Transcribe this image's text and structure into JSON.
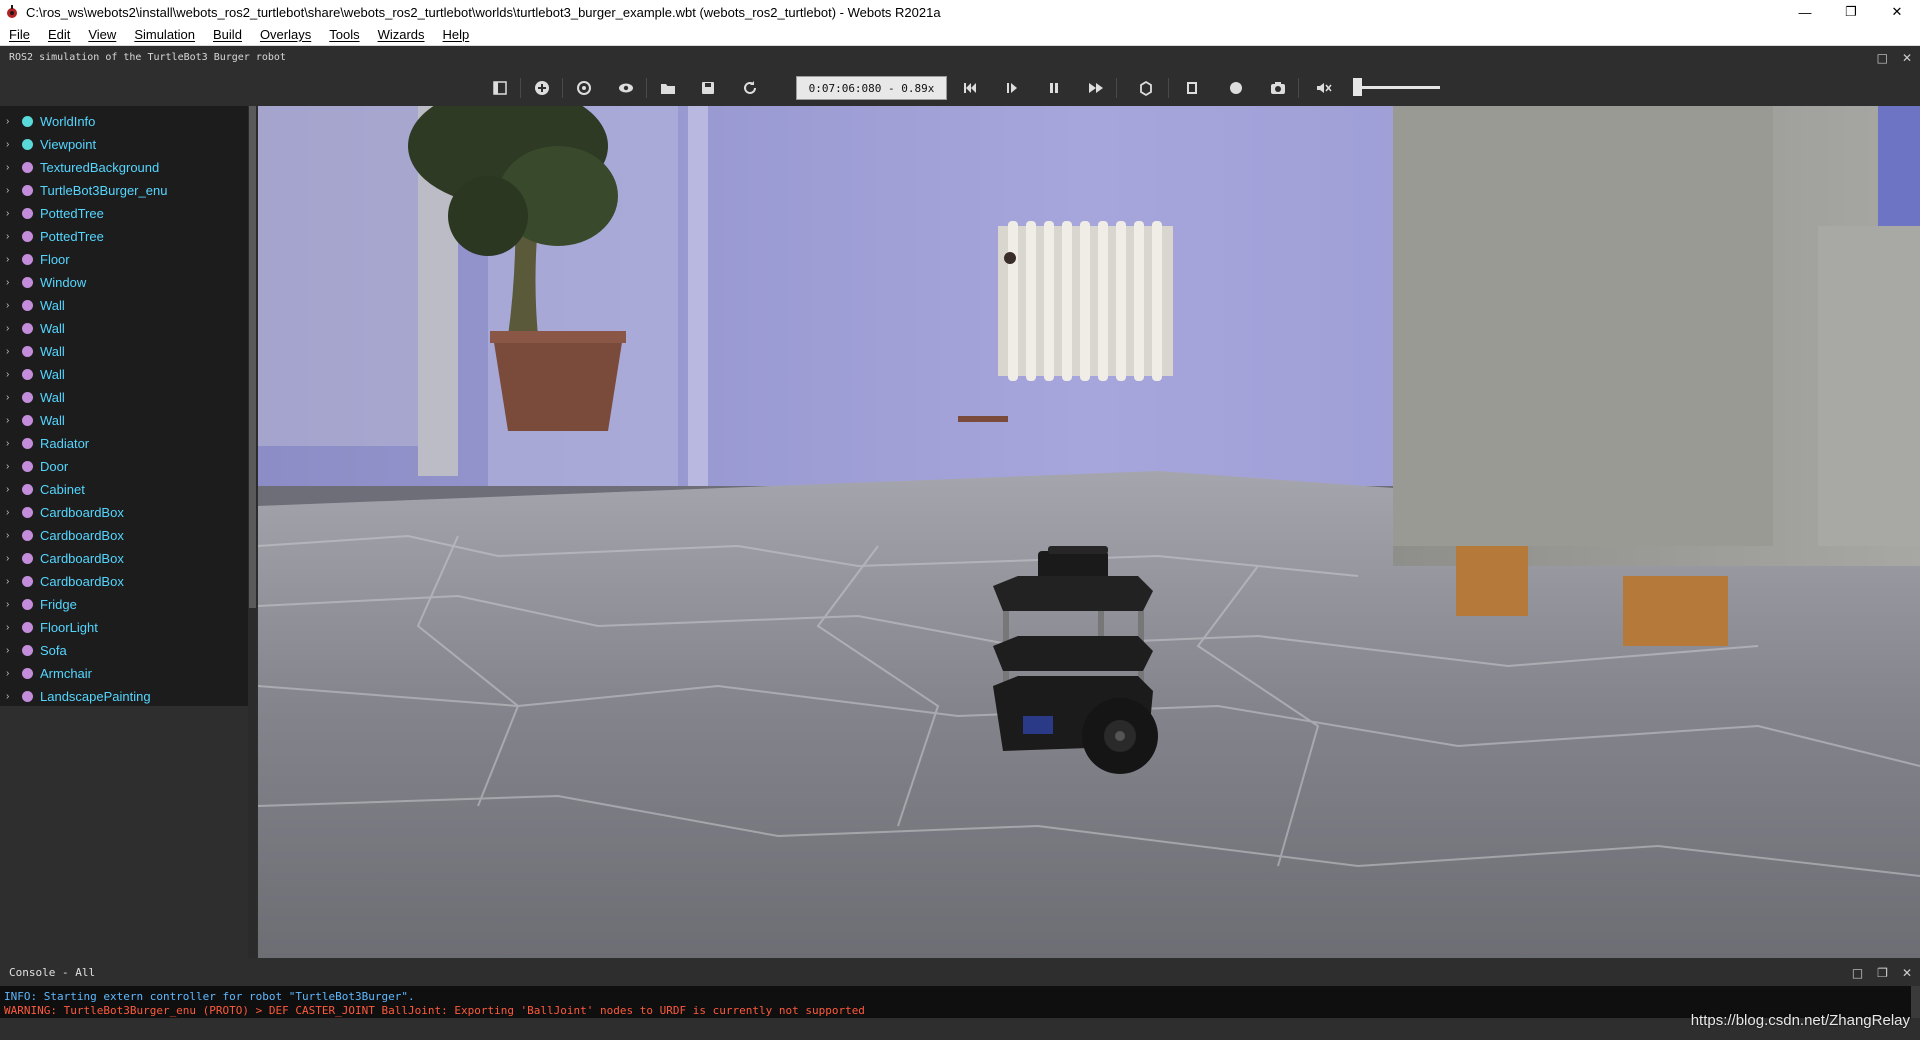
{
  "window": {
    "title": "C:\\ros_ws\\webots2\\install\\webots_ros2_turtlebot\\share\\webots_ros2_turtlebot\\worlds\\turtlebot3_burger_example.wbt (webots_ros2_turtlebot) - Webots R2021a",
    "minimize": "—",
    "restore": "❐",
    "close": "✕"
  },
  "menu": [
    "File",
    "Edit",
    "View",
    "Simulation",
    "Build",
    "Overlays",
    "Tools",
    "Wizards",
    "Help"
  ],
  "world_description": "ROS2 simulation of the TurtleBot3 Burger robot",
  "dock": {
    "float": "□",
    "close": "✕"
  },
  "toolbar": {
    "time": "0:07:06:080 - 0.89x"
  },
  "scene_tree": {
    "items": [
      {
        "label": "WorldInfo",
        "color": "#59d9d9"
      },
      {
        "label": "Viewpoint",
        "color": "#59d9d9"
      },
      {
        "label": "TexturedBackground",
        "color": "#c48ddc"
      },
      {
        "label": "TurtleBot3Burger_enu",
        "color": "#c48ddc"
      },
      {
        "label": "PottedTree",
        "color": "#c48ddc"
      },
      {
        "label": "PottedTree",
        "color": "#c48ddc"
      },
      {
        "label": "Floor",
        "color": "#c48ddc"
      },
      {
        "label": "Window",
        "color": "#c48ddc"
      },
      {
        "label": "Wall",
        "color": "#c48ddc"
      },
      {
        "label": "Wall",
        "color": "#c48ddc"
      },
      {
        "label": "Wall",
        "color": "#c48ddc"
      },
      {
        "label": "Wall",
        "color": "#c48ddc"
      },
      {
        "label": "Wall",
        "color": "#c48ddc"
      },
      {
        "label": "Wall",
        "color": "#c48ddc"
      },
      {
        "label": "Radiator",
        "color": "#c48ddc"
      },
      {
        "label": "Door",
        "color": "#c48ddc"
      },
      {
        "label": "Cabinet",
        "color": "#c48ddc"
      },
      {
        "label": "CardboardBox",
        "color": "#c48ddc"
      },
      {
        "label": "CardboardBox",
        "color": "#c48ddc"
      },
      {
        "label": "CardboardBox",
        "color": "#c48ddc"
      },
      {
        "label": "CardboardBox",
        "color": "#c48ddc"
      },
      {
        "label": "Fridge",
        "color": "#c48ddc"
      },
      {
        "label": "FloorLight",
        "color": "#c48ddc"
      },
      {
        "label": "Sofa",
        "color": "#c48ddc"
      },
      {
        "label": "Armchair",
        "color": "#c48ddc"
      },
      {
        "label": "LandscapePainting",
        "color": "#c48ddc"
      }
    ]
  },
  "console": {
    "title": "Console - All",
    "info": "INFO: Starting extern controller for robot \"TurtleBot3Burger\".",
    "warning": "WARNING: TurtleBot3Burger_enu (PROTO) > DEF CASTER_JOINT BallJoint: Exporting 'BallJoint' nodes to URDF is currently not supported"
  },
  "watermark": "https://blog.csdn.net/ZhangRelay",
  "colors": {
    "tree_text": "#55d6ff",
    "wall": "#9b9bd3",
    "console_info": "#5eb8ff",
    "console_warning": "#ff5a3c"
  }
}
